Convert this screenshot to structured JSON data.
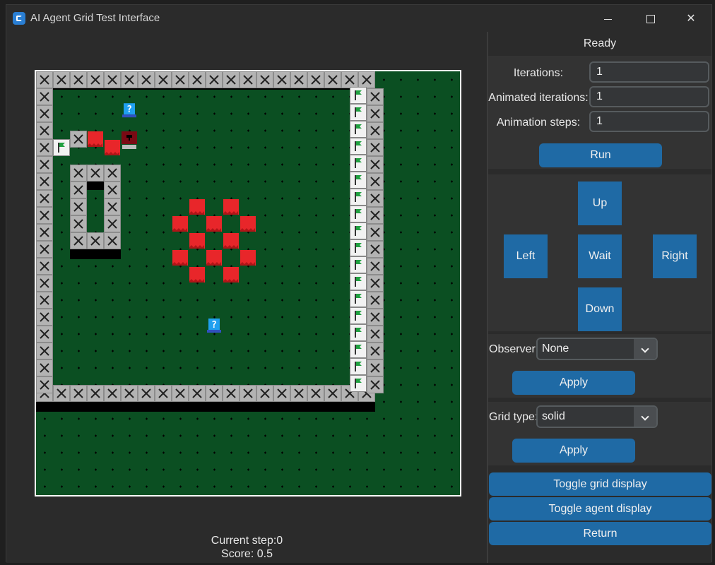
{
  "window": {
    "title": "AI Agent Grid Test Interface"
  },
  "status": {
    "current_step": "Current step:0",
    "score": "Score: 0.5"
  },
  "panel": {
    "ready": "Ready",
    "iterations_label": "Iterations:",
    "iterations_value": "1",
    "animated_label": "Animated iterations:",
    "animated_value": "1",
    "steps_label": "Animation steps:",
    "steps_value": "1",
    "run": "Run",
    "up": "Up",
    "left": "Left",
    "wait": "Wait",
    "right": "Right",
    "down": "Down",
    "observer_label": "Observer:",
    "observer_value": "None",
    "apply1": "Apply",
    "grid_type_label": "Grid type:",
    "grid_type_value": "solid",
    "apply2": "Apply",
    "toggle_grid": "Toggle grid display",
    "toggle_agent": "Toggle agent display",
    "return": "Return"
  },
  "colors": {
    "grass": "#0b4f22",
    "wall": "#b3b3b3",
    "lava": "#e8262a",
    "button": "#1f6aa5"
  },
  "icons": {
    "wall": "x-wall-icon",
    "flag": "green-flag-icon",
    "mystery": "question-block-icon",
    "agent": "agent-icon"
  }
}
